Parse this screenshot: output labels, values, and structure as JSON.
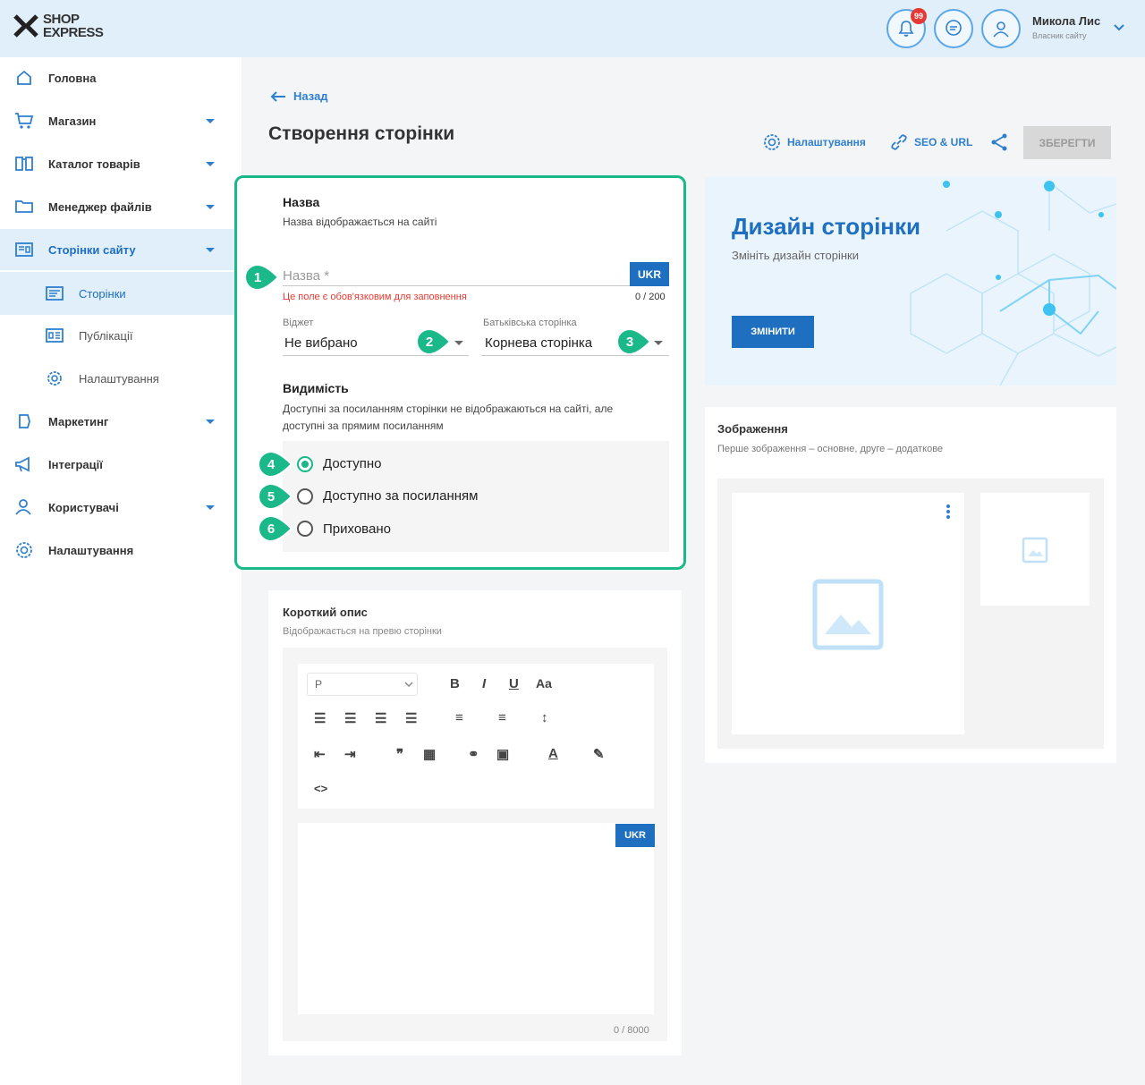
{
  "header": {
    "logo_line1": "SHOP",
    "logo_line2": "EXPRESS",
    "notification_count": "99",
    "user_name": "Микола Лис",
    "user_role": "Власник сайту"
  },
  "sidebar": {
    "items": [
      {
        "label": "Головна",
        "icon": "home-icon"
      },
      {
        "label": "Магазин",
        "icon": "cart-icon"
      },
      {
        "label": "Каталог товарів",
        "icon": "catalog-icon"
      },
      {
        "label": "Менеджер файлів",
        "icon": "folder-icon"
      },
      {
        "label": "Сторінки сайту",
        "icon": "pages-icon"
      },
      {
        "label": "Сторінки",
        "icon": "page-icon"
      },
      {
        "label": "Публікації",
        "icon": "publications-icon"
      },
      {
        "label": "Налаштування",
        "icon": "gear-icon"
      },
      {
        "label": "Маркетинг",
        "icon": "marketing-icon"
      },
      {
        "label": "Інтеграції",
        "icon": "megaphone-icon"
      },
      {
        "label": "Користувачі",
        "icon": "users-icon"
      },
      {
        "label": "Налаштування",
        "icon": "gear-icon"
      }
    ]
  },
  "page": {
    "back_label": "Назад",
    "title": "Створення сторінки",
    "toolbar": {
      "settings_label": "Налаштування",
      "seo_label": "SEO & URL",
      "save_label": "ЗБЕРЕГТИ"
    }
  },
  "form": {
    "name_title": "Назва",
    "name_desc": "Назва відображається на сайті",
    "name_placeholder": "Назва *",
    "lang_button": "UKR",
    "name_error": "Це поле є обов'язковим для заповнення",
    "name_counter": "0 / 200",
    "widget_label": "Віджет",
    "widget_value": "Не вибрано",
    "parent_label": "Батьківська сторінка",
    "parent_value": "Корнева сторінка",
    "visibility_title": "Видимість",
    "visibility_desc_1": "Доступні за посиланням сторінки не відображаються на сайті, але",
    "visibility_desc_2": "доступні за прямим посиланням",
    "options": [
      {
        "label": "Доступно",
        "checked": true
      },
      {
        "label": "Доступно за посиланням",
        "checked": false
      },
      {
        "label": "Приховано",
        "checked": false
      }
    ],
    "markers": [
      "1",
      "2",
      "3",
      "4",
      "5",
      "6"
    ],
    "highlight_color": "#1bb98a"
  },
  "design": {
    "title": "Дизайн сторінки",
    "subtitle": "Змініть дизайн сторінки",
    "button": "ЗМІНИТИ"
  },
  "images": {
    "title": "Зображення",
    "desc": "Перше зображення – основне, друге – додаткове"
  },
  "short_desc": {
    "title": "Короткий опис",
    "desc": "Відображається на превю сторінки",
    "paragraph_select": "P",
    "font_size_label": "Aa",
    "lang_button": "UKR",
    "counter": "0 / 8000"
  }
}
